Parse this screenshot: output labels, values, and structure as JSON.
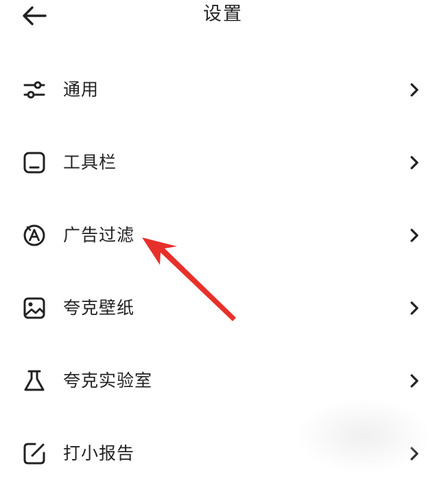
{
  "header": {
    "title": "设置",
    "back_icon": "arrow-left-icon"
  },
  "menu": {
    "items": [
      {
        "label": "通用",
        "icon": "sliders-icon"
      },
      {
        "label": "工具栏",
        "icon": "toolbar-icon"
      },
      {
        "label": "广告过滤",
        "icon": "ad-filter-icon"
      },
      {
        "label": "夸克壁纸",
        "icon": "image-icon"
      },
      {
        "label": "夸克实验室",
        "icon": "flask-icon"
      },
      {
        "label": "打小报告",
        "icon": "edit-report-icon"
      }
    ],
    "chevron_icon": "chevron-right-icon"
  },
  "annotation": {
    "arrow_color": "#e8302a"
  }
}
